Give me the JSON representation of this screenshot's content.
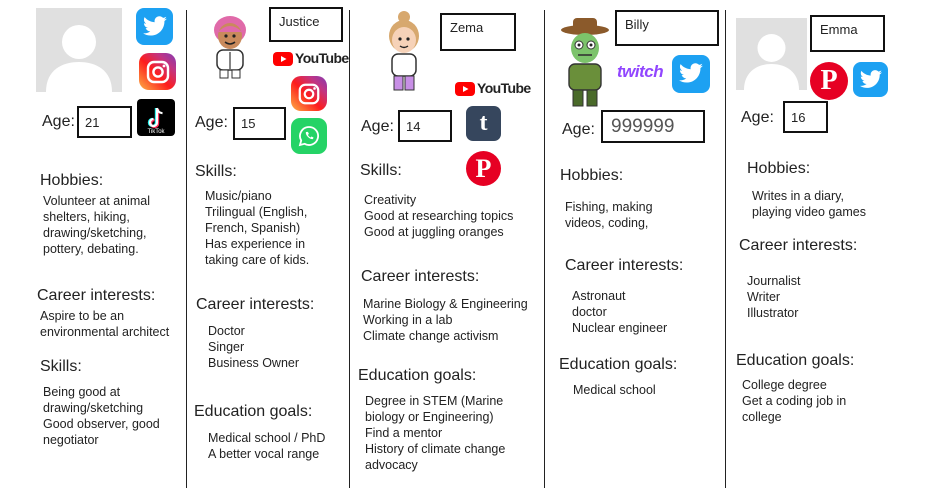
{
  "profiles": [
    {
      "name": "",
      "age_label": "Age:",
      "age": "21",
      "sections": [
        {
          "title": "Hobbies:",
          "lines": [
            "Volunteer at animal",
            "shelters, hiking,",
            "drawing/sketching,",
            "pottery, debating."
          ]
        },
        {
          "title": "Career interests:",
          "lines": [
            "Aspire to be an",
            "environmental architect"
          ]
        },
        {
          "title": "Skills:",
          "lines": [
            "Being good at",
            "drawing/sketching",
            "Good observer, good",
            "negotiator"
          ]
        }
      ],
      "icons": [
        "twitter-icon",
        "instagram-icon",
        "tiktok-icon"
      ]
    },
    {
      "name": "Justice",
      "age_label": "Age:",
      "age": "15",
      "sections": [
        {
          "title": "Skills:",
          "lines": [
            "Music/piano",
            "Trilingual (English,",
            "French, Spanish)",
            "Has experience in",
            "taking care of kids."
          ]
        },
        {
          "title": "Career interests:",
          "lines": [
            "Doctor",
            "Singer",
            "Business Owner"
          ]
        },
        {
          "title": "Education goals:",
          "lines": [
            "Medical school / PhD",
            "A better vocal range"
          ]
        }
      ],
      "icons": [
        "youtube-icon",
        "instagram-icon",
        "whatsapp-icon"
      ]
    },
    {
      "name": "Zema",
      "age_label": "Age:",
      "age": "14",
      "sections": [
        {
          "title": "Skills:",
          "lines": [
            "Creativity",
            "Good at researching topics",
            "Good at juggling oranges"
          ]
        },
        {
          "title": "Career interests:",
          "lines": [
            "Marine Biology & Engineering",
            "Working in a lab",
            "Climate change activism"
          ]
        },
        {
          "title": "Education goals:",
          "lines": [
            "Degree in STEM (Marine",
            "biology or Engineering)",
            "Find a mentor",
            "History of climate change",
            "advocacy"
          ]
        }
      ],
      "icons": [
        "youtube-icon",
        "tumblr-icon",
        "pinterest-icon"
      ]
    },
    {
      "name": "Billy",
      "age_label": "Age:",
      "age": "999999",
      "sections": [
        {
          "title": "Hobbies:",
          "lines": [
            "Fishing, making",
            "videos, coding,"
          ]
        },
        {
          "title": "Career interests:",
          "lines": [
            "Astronaut",
            "doctor",
            "Nuclear engineer"
          ]
        },
        {
          "title": "Education goals:",
          "lines": [
            "Medical school"
          ]
        }
      ],
      "icons": [
        "twitch-icon",
        "twitter-icon"
      ]
    },
    {
      "name": "Emma",
      "age_label": "Age:",
      "age": "16",
      "sections": [
        {
          "title": "Hobbies:",
          "lines": [
            "Writes in a diary,",
            "playing video games"
          ]
        },
        {
          "title": "Career interests:",
          "lines": [
            "Journalist",
            "Writer",
            "Illustrator"
          ]
        },
        {
          "title": "Education goals:",
          "lines": [
            "College degree",
            "Get a coding job in",
            "college"
          ]
        }
      ],
      "icons": [
        "pinterest-icon",
        "twitter-icon"
      ]
    }
  ],
  "brand_text": {
    "youtube": "YouTube",
    "twitch": "twitch",
    "tumblr": "t",
    "tiktok": "TikTok"
  },
  "colors": {
    "twitter": "#1da1f2",
    "youtube": "#ff0000",
    "pinterest": "#e60023",
    "tumblr": "#36465d",
    "twitch": "#9146ff",
    "whatsapp": "#25d366",
    "tiktok": "#000000"
  }
}
